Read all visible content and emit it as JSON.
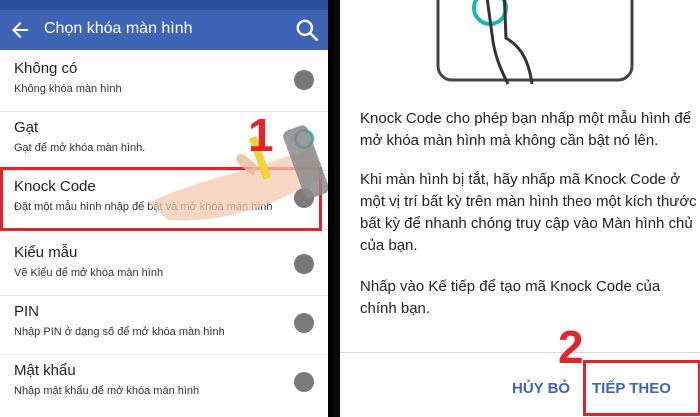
{
  "left": {
    "header": {
      "title": "Chọn khóa màn hình"
    },
    "items": [
      {
        "title": "Không có",
        "subtitle": "Không khóa màn hình"
      },
      {
        "title": "Gạt",
        "subtitle": "Gạt để mở khóa màn hình."
      },
      {
        "title": "Knock Code",
        "subtitle": "Đặt một mẫu hình nhập để bật và mở khóa màn hình"
      },
      {
        "title": "Kiểu mẫu",
        "subtitle": "Vẽ Kiểu để mở khóa màn hình"
      },
      {
        "title": "PIN",
        "subtitle": "Nhập PIN ở dạng số để mở khóa màn hình"
      },
      {
        "title": "Mật khẩu",
        "subtitle": "Nhập mật khẩu để mở khóa màn hình"
      }
    ],
    "step_label": "1"
  },
  "right": {
    "paragraphs": [
      "Knock Code cho phép bạn nhấp một mẫu hình để mở khóa màn hình mà không cần bật nó lên.",
      "Khi màn hình bị tắt, hãy nhấp mã Knock Code ở một vị trí bất kỳ trên màn hình theo một kích thước bất kỳ để nhanh chóng truy cập vào Màn hình chủ của bạn.",
      "Nhấp vào Kế tiếp để tạo mã Knock Code của chính bạn."
    ],
    "cancel_label": "HỦY BỎ",
    "next_label": "TIẾP THEO",
    "step_label": "2"
  },
  "colors": {
    "accent": "#3f64b6",
    "highlight": "#e0262a"
  }
}
